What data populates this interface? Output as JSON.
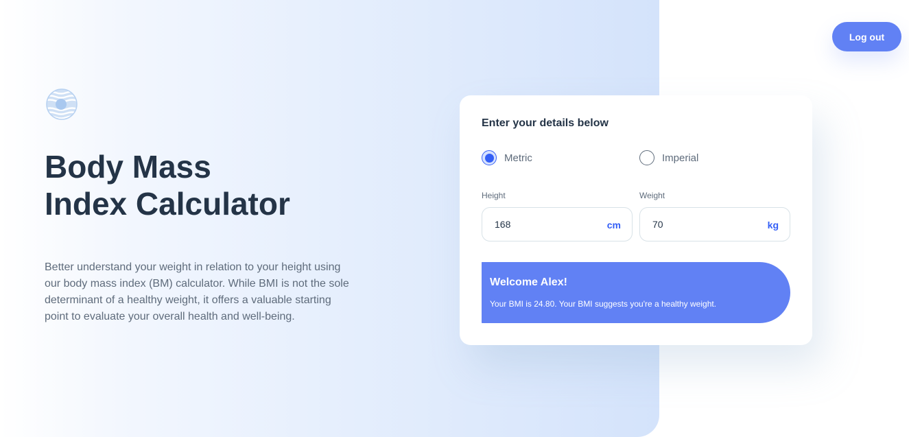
{
  "header": {
    "logout_label": "Log out"
  },
  "hero": {
    "title_line1": "Body Mass",
    "title_line2": "Index Calculator",
    "description": "Better understand your weight in relation to your height using our body mass index (BM) calculator. While BMI is not the sole determinant of a healthy weight, it offers a valuable starting point to evaluate your overall health and well-being.",
    "logo_icon": "logo-icon"
  },
  "form": {
    "heading": "Enter your details below",
    "units": {
      "metric_label": "Metric",
      "imperial_label": "Imperial",
      "selected": "Metric"
    },
    "height": {
      "label": "Height",
      "value": "168",
      "unit": "cm"
    },
    "weight": {
      "label": "Weight",
      "value": "70",
      "unit": "kg"
    },
    "result": {
      "title": "Welcome Alex!",
      "message": "Your BMI is 24.80. Your BMI suggests you're a healthy weight."
    }
  },
  "colors": {
    "accent": "#6181f4",
    "primary_blue": "#345ff6",
    "heading": "#243447",
    "body_text": "#5e6b7b"
  }
}
